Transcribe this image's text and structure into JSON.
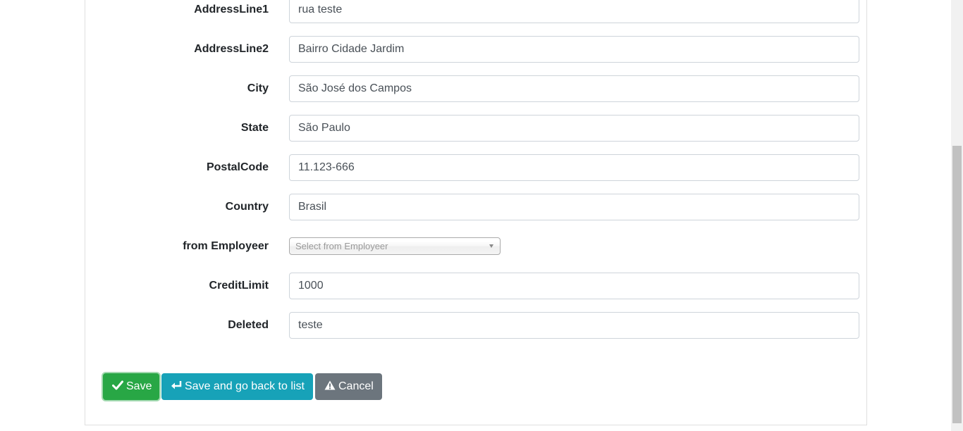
{
  "form": {
    "fields": [
      {
        "label": "AddressLine1",
        "value": "rua teste"
      },
      {
        "label": "AddressLine2",
        "value": "Bairro Cidade Jardim"
      },
      {
        "label": "City",
        "value": "São José dos Campos"
      },
      {
        "label": "State",
        "value": "São Paulo"
      },
      {
        "label": "PostalCode",
        "value": "11.123-666"
      },
      {
        "label": "Country",
        "value": "Brasil"
      }
    ],
    "employee_select": {
      "label": "from Employeer",
      "placeholder": "Select from Employeer"
    },
    "fields_after": [
      {
        "label": "CreditLimit",
        "value": "1000"
      },
      {
        "label": "Deleted",
        "value": "teste"
      }
    ]
  },
  "buttons": {
    "save": {
      "label": "Save",
      "icon": "check-icon",
      "color": "#28a745"
    },
    "save_back": {
      "label": "Save and go back to list",
      "icon": "return-arrow-icon",
      "color": "#17a2b8"
    },
    "cancel": {
      "label": "Cancel",
      "icon": "warning-icon",
      "color": "#6c757d"
    }
  }
}
